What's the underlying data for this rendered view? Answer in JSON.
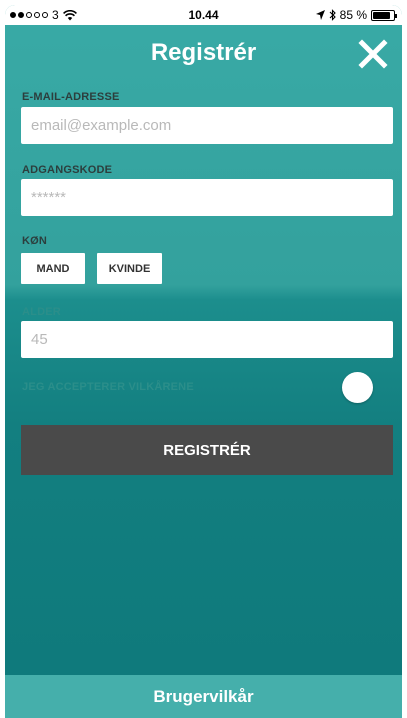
{
  "status_bar": {
    "carrier": "3",
    "signal_dots_filled": 2,
    "signal_dots_total": 5,
    "time": "10.44",
    "battery_percent_label": "85 %",
    "battery_level": 0.85,
    "icons": [
      "wifi-icon",
      "location-arrow-icon",
      "bluetooth-icon",
      "battery-icon"
    ]
  },
  "header": {
    "title": "Registrér",
    "close_icon": "close-icon"
  },
  "form": {
    "email": {
      "label": "E-MAIL-ADRESSE",
      "placeholder": "email@example.com",
      "value": ""
    },
    "password": {
      "label": "ADGANGSKODE",
      "placeholder": "******",
      "value": ""
    },
    "gender": {
      "label": "KØN",
      "options": [
        "MAND",
        "KVINDE"
      ]
    },
    "age": {
      "label": "ALDER",
      "placeholder": "45",
      "value": ""
    },
    "terms": {
      "label": "JEG ACCEPTERER VILKÅRENE"
    },
    "submit_label": "REGISTRÉR"
  },
  "footer": {
    "label": "Brugervilkår"
  },
  "colors": {
    "teal_top": "#39aaa6",
    "teal_bottom": "#0e797b",
    "button_dark": "#4a4a4a",
    "footer": "#45afab"
  }
}
